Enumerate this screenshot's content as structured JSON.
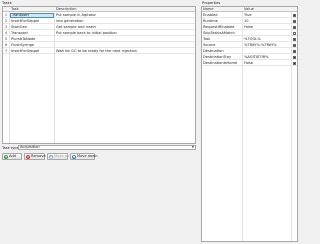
{
  "tasks_pane": {
    "title": "Tasks",
    "columns": [
      "",
      "Task",
      "Description"
    ],
    "rows": [
      {
        "num": "1",
        "task": "Transport",
        "description": "Put sample in Agitator",
        "selected": true
      },
      {
        "num": "2",
        "task": "InsertForSeppel",
        "description": "into generation"
      },
      {
        "num": "3",
        "task": "StartGen",
        "description": "Get sample and insert"
      },
      {
        "num": "4",
        "task": "Transport",
        "description": "Put sample back to initial position"
      },
      {
        "num": "5",
        "task": "PlumbToNode",
        "description": ""
      },
      {
        "num": "6",
        "task": "FlushSyringe",
        "description": ""
      },
      {
        "num": "7",
        "task": "InsertForSeppel",
        "description": "Wait for GC to be ready for the next injection"
      }
    ]
  },
  "properties_pane": {
    "title": "Properties",
    "columns": [
      "Name",
      "Value",
      ""
    ],
    "rows": [
      {
        "name": "Enabled",
        "value": "True",
        "checked": true
      },
      {
        "name": "Runtime",
        "value": "10",
        "checked": true
      },
      {
        "name": "RequestIfEnabled",
        "value": "False",
        "checked": true
      },
      {
        "name": "SkipTaskIsAMatch",
        "value": "",
        "checked": false
      },
      {
        "name": "Tool",
        "value": "%TOOL%",
        "checked": true
      },
      {
        "name": "Source",
        "value": "%TRAY%:%TRAY%",
        "checked": true
      },
      {
        "name": "Destination",
        "value": "",
        "checked": true
      },
      {
        "name": "DestinationTray",
        "value": "%AGITATOR%",
        "checked": true
      },
      {
        "name": "DestinationIsHome",
        "value": "False",
        "checked": true
      }
    ]
  },
  "task_type": {
    "label": "Task type:",
    "value": "Acquisition"
  },
  "buttons": {
    "add": "Add",
    "remove": "Remove",
    "move_up": "Move up",
    "move_down": "Move down"
  }
}
